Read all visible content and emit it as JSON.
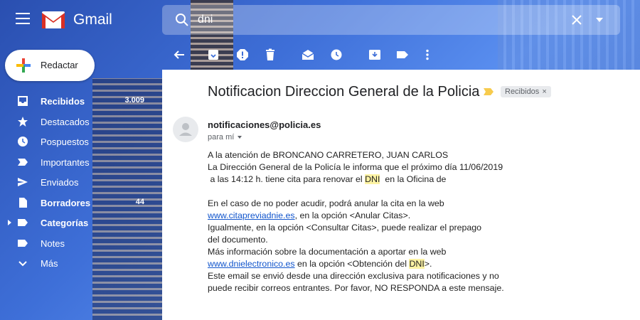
{
  "app": {
    "name": "Gmail"
  },
  "search": {
    "value": "dni"
  },
  "compose": {
    "label": "Redactar"
  },
  "sidebar": {
    "items": [
      {
        "label": "Recibidos",
        "count": "3.009"
      },
      {
        "label": "Destacados",
        "count": ""
      },
      {
        "label": "Pospuestos",
        "count": ""
      },
      {
        "label": "Importantes",
        "count": ""
      },
      {
        "label": "Enviados",
        "count": ""
      },
      {
        "label": "Borradores",
        "count": "44"
      },
      {
        "label": "Categorías",
        "count": ""
      },
      {
        "label": "Notes",
        "count": ""
      },
      {
        "label": "Más",
        "count": ""
      }
    ]
  },
  "toolbar": {
    "icons": [
      "back-arrow-icon",
      "archive-icon",
      "report-spam-icon",
      "delete-icon",
      "mark-unread-icon",
      "snooze-icon",
      "move-to-icon",
      "label-icon",
      "more-vert-icon"
    ]
  },
  "email": {
    "subject": "Notificacion Direccion General de la Policia",
    "label_chip": "Recibidos",
    "sender": "notificaciones@policia.es",
    "to": "para mí",
    "body": {
      "l1": "A la atención de BRONCANO CARRETERO, JUAN CARLOS",
      "l2": "La Dirección General de la Policía le informa que el próximo día 11/06/2019",
      "l3a": " a las 14:12 h. tiene cita para renovar el ",
      "l3b": "DNI",
      "l3c": "  en la Oficina de",
      "l4": "En el caso de no poder acudir, podrá anular la cita en la web",
      "l5a": "www.citapreviadnie.es",
      "l5b": ", en la opción <Anular Citas>.",
      "l6": "Igualmente, en la opción <Consultar Citas>, puede realizar el prepago",
      "l7": "del documento.",
      "l8": "Más información sobre la documentación a aportar en la web",
      "l9a": "www.dnielectronico.es",
      "l9b": " en la opción <Obtención del ",
      "l9c": "DNI",
      "l9d": ">.",
      "l10": "Este email se envió desde una dirección exclusiva para notificaciones y no",
      "l11": "puede recibir correos entrantes. Por favor, NO RESPONDA a este mensaje."
    }
  },
  "colors": {
    "highlight": "#fdf3a4",
    "link": "#1155cc",
    "importance": "#f7cb4d"
  }
}
